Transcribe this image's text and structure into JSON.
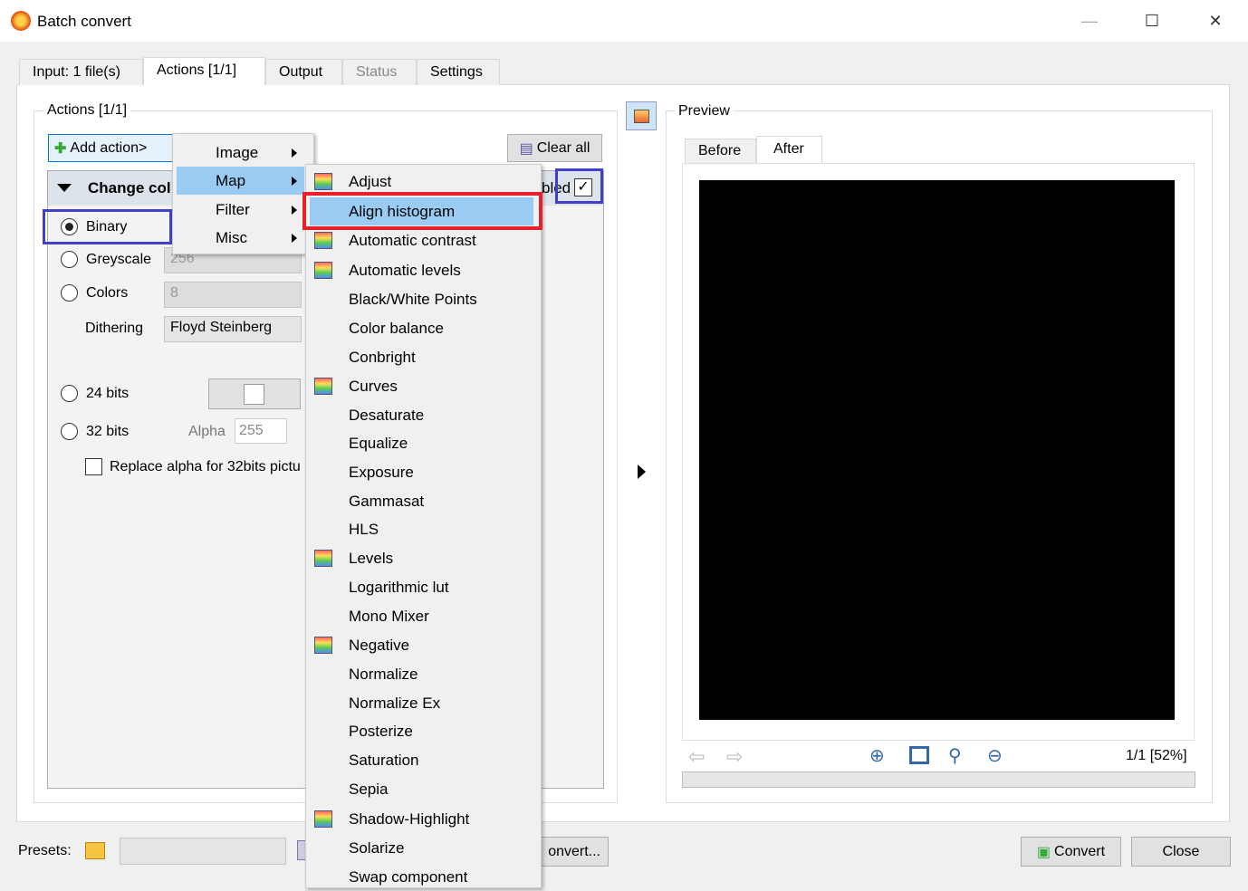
{
  "window": {
    "title": "Batch convert",
    "minimize": "—",
    "maximize": "☐",
    "close": "✕"
  },
  "tabs": [
    {
      "label": "Input: 1 file(s)"
    },
    {
      "label": "Actions [1/1]"
    },
    {
      "label": "Output"
    },
    {
      "label": "Status"
    },
    {
      "label": "Settings"
    }
  ],
  "actions": {
    "group_label": "Actions [1/1]",
    "add_action": "Add action>",
    "clear_all": "Clear all",
    "action_title": "Change col",
    "enabled_label": "bled",
    "enabled": true,
    "options": {
      "binary": "Binary",
      "greyscale": "Greyscale",
      "greyscale_value": "256",
      "colors": "Colors",
      "colors_value": "8",
      "dithering": "Dithering",
      "dithering_value": "Floyd Steinberg",
      "bits24": "24 bits",
      "bits32": "32 bits",
      "alpha": "Alpha",
      "alpha_value": "255",
      "replace_alpha": "Replace alpha for 32bits pictu"
    },
    "selected": "Binary"
  },
  "menu": {
    "items": [
      {
        "label": "Image"
      },
      {
        "label": "Map"
      },
      {
        "label": "Filter"
      },
      {
        "label": "Misc"
      }
    ],
    "highlighted": "Map"
  },
  "submenu": {
    "items": [
      {
        "label": "Adjust",
        "icon": "adjust-icon"
      },
      {
        "label": "Align histogram"
      },
      {
        "label": "Automatic contrast",
        "icon": "contrast-icon"
      },
      {
        "label": "Automatic levels",
        "icon": "levels-icon"
      },
      {
        "label": "Black/White Points"
      },
      {
        "label": "Color balance"
      },
      {
        "label": "Conbright"
      },
      {
        "label": "Curves",
        "icon": "curves-icon"
      },
      {
        "label": "Desaturate"
      },
      {
        "label": "Equalize"
      },
      {
        "label": "Exposure"
      },
      {
        "label": "Gammasat"
      },
      {
        "label": "HLS"
      },
      {
        "label": "Levels",
        "icon": "levels-icon"
      },
      {
        "label": "Logarithmic lut"
      },
      {
        "label": "Mono Mixer"
      },
      {
        "label": "Negative",
        "icon": "negative-icon"
      },
      {
        "label": "Normalize"
      },
      {
        "label": "Normalize Ex"
      },
      {
        "label": "Posterize"
      },
      {
        "label": "Saturation"
      },
      {
        "label": "Sepia"
      },
      {
        "label": "Shadow-Highlight",
        "icon": "shadow-highlight-icon"
      },
      {
        "label": "Solarize"
      },
      {
        "label": "Swap component"
      }
    ],
    "highlighted": "Align histogram"
  },
  "preview": {
    "label": "Preview",
    "tabs": [
      "Before",
      "After"
    ],
    "active_tab": "After",
    "page_info": "1/1 [52%]"
  },
  "footer": {
    "presets": "Presets:",
    "preset_value": "",
    "convert_partial": "onvert...",
    "convert": "Convert",
    "close": "Close"
  },
  "colors": {
    "highlight": "#99cbf3",
    "red_box": "#e8202a",
    "blue_box": "#4040cc"
  }
}
